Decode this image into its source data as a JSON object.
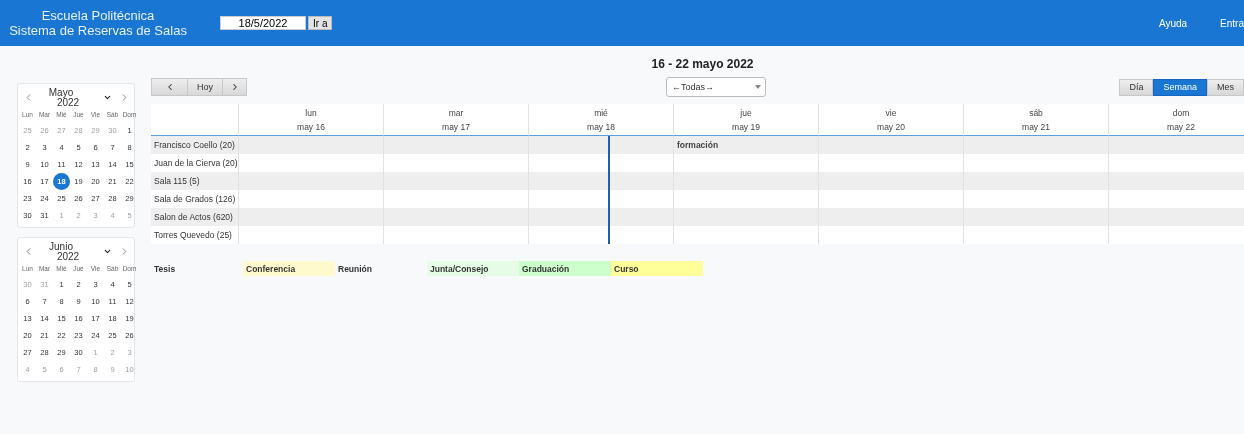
{
  "header": {
    "title_lines": [
      "Escuela Politécnica",
      "Sistema de Reservas de Salas"
    ],
    "date_field": {
      "value": "18/5/2022"
    },
    "go_button": "Ir a",
    "links": [
      "Ayuda",
      "Entra"
    ]
  },
  "mini_calendars": [
    {
      "month": "Mayo",
      "year": "2022",
      "weekdays": [
        "Lun",
        "Mar",
        "Mié",
        "Jue",
        "Vie",
        "Sáb",
        "Dom"
      ],
      "days": [
        {
          "label": "25",
          "outside": true,
          "selected": false
        },
        {
          "label": "26",
          "outside": true,
          "selected": false
        },
        {
          "label": "27",
          "outside": true,
          "selected": false
        },
        {
          "label": "28",
          "outside": true,
          "selected": false
        },
        {
          "label": "29",
          "outside": true,
          "selected": false
        },
        {
          "label": "30",
          "outside": true,
          "selected": false
        },
        {
          "label": "1",
          "outside": false,
          "selected": false
        },
        {
          "label": "2",
          "outside": false,
          "selected": false
        },
        {
          "label": "3",
          "outside": false,
          "selected": false
        },
        {
          "label": "4",
          "outside": false,
          "selected": false
        },
        {
          "label": "5",
          "outside": false,
          "selected": false
        },
        {
          "label": "6",
          "outside": false,
          "selected": false
        },
        {
          "label": "7",
          "outside": false,
          "selected": false
        },
        {
          "label": "8",
          "outside": false,
          "selected": false
        },
        {
          "label": "9",
          "outside": false,
          "selected": false
        },
        {
          "label": "10",
          "outside": false,
          "selected": false
        },
        {
          "label": "11",
          "outside": false,
          "selected": false
        },
        {
          "label": "12",
          "outside": false,
          "selected": false
        },
        {
          "label": "13",
          "outside": false,
          "selected": false
        },
        {
          "label": "14",
          "outside": false,
          "selected": false
        },
        {
          "label": "15",
          "outside": false,
          "selected": false
        },
        {
          "label": "16",
          "outside": false,
          "selected": false
        },
        {
          "label": "17",
          "outside": false,
          "selected": false
        },
        {
          "label": "18",
          "outside": false,
          "selected": true
        },
        {
          "label": "19",
          "outside": false,
          "selected": false
        },
        {
          "label": "20",
          "outside": false,
          "selected": false
        },
        {
          "label": "21",
          "outside": false,
          "selected": false
        },
        {
          "label": "22",
          "outside": false,
          "selected": false
        },
        {
          "label": "23",
          "outside": false,
          "selected": false
        },
        {
          "label": "24",
          "outside": false,
          "selected": false
        },
        {
          "label": "25",
          "outside": false,
          "selected": false
        },
        {
          "label": "26",
          "outside": false,
          "selected": false
        },
        {
          "label": "27",
          "outside": false,
          "selected": false
        },
        {
          "label": "28",
          "outside": false,
          "selected": false
        },
        {
          "label": "29",
          "outside": false,
          "selected": false
        },
        {
          "label": "30",
          "outside": false,
          "selected": false
        },
        {
          "label": "31",
          "outside": false,
          "selected": false
        },
        {
          "label": "1",
          "outside": true,
          "selected": false
        },
        {
          "label": "2",
          "outside": true,
          "selected": false
        },
        {
          "label": "3",
          "outside": true,
          "selected": false
        },
        {
          "label": "4",
          "outside": true,
          "selected": false
        },
        {
          "label": "5",
          "outside": true,
          "selected": false
        }
      ]
    },
    {
      "month": "Junio",
      "year": "2022",
      "weekdays": [
        "Lun",
        "Mar",
        "Mié",
        "Jue",
        "Vie",
        "Sáb",
        "Dom"
      ],
      "days": [
        {
          "label": "30",
          "outside": true,
          "selected": false
        },
        {
          "label": "31",
          "outside": true,
          "selected": false
        },
        {
          "label": "1",
          "outside": false,
          "selected": false
        },
        {
          "label": "2",
          "outside": false,
          "selected": false
        },
        {
          "label": "3",
          "outside": false,
          "selected": false
        },
        {
          "label": "4",
          "outside": false,
          "selected": false
        },
        {
          "label": "5",
          "outside": false,
          "selected": false
        },
        {
          "label": "6",
          "outside": false,
          "selected": false
        },
        {
          "label": "7",
          "outside": false,
          "selected": false
        },
        {
          "label": "8",
          "outside": false,
          "selected": false
        },
        {
          "label": "9",
          "outside": false,
          "selected": false
        },
        {
          "label": "10",
          "outside": false,
          "selected": false
        },
        {
          "label": "11",
          "outside": false,
          "selected": false
        },
        {
          "label": "12",
          "outside": false,
          "selected": false
        },
        {
          "label": "13",
          "outside": false,
          "selected": false
        },
        {
          "label": "14",
          "outside": false,
          "selected": false
        },
        {
          "label": "15",
          "outside": false,
          "selected": false
        },
        {
          "label": "16",
          "outside": false,
          "selected": false
        },
        {
          "label": "17",
          "outside": false,
          "selected": false
        },
        {
          "label": "18",
          "outside": false,
          "selected": false
        },
        {
          "label": "19",
          "outside": false,
          "selected": false
        },
        {
          "label": "20",
          "outside": false,
          "selected": false
        },
        {
          "label": "21",
          "outside": false,
          "selected": false
        },
        {
          "label": "22",
          "outside": false,
          "selected": false
        },
        {
          "label": "23",
          "outside": false,
          "selected": false
        },
        {
          "label": "24",
          "outside": false,
          "selected": false
        },
        {
          "label": "25",
          "outside": false,
          "selected": false
        },
        {
          "label": "26",
          "outside": false,
          "selected": false
        },
        {
          "label": "27",
          "outside": false,
          "selected": false
        },
        {
          "label": "28",
          "outside": false,
          "selected": false
        },
        {
          "label": "29",
          "outside": false,
          "selected": false
        },
        {
          "label": "30",
          "outside": false,
          "selected": false
        },
        {
          "label": "1",
          "outside": true,
          "selected": false
        },
        {
          "label": "2",
          "outside": true,
          "selected": false
        },
        {
          "label": "3",
          "outside": true,
          "selected": false
        },
        {
          "label": "4",
          "outside": true,
          "selected": false
        },
        {
          "label": "5",
          "outside": true,
          "selected": false
        },
        {
          "label": "6",
          "outside": true,
          "selected": false
        },
        {
          "label": "7",
          "outside": true,
          "selected": false
        },
        {
          "label": "8",
          "outside": true,
          "selected": false
        },
        {
          "label": "9",
          "outside": true,
          "selected": false
        },
        {
          "label": "10",
          "outside": true,
          "selected": false
        }
      ]
    }
  ],
  "range_title": "16 - 22 mayo 2022",
  "nav": {
    "today": "Hoy"
  },
  "room_filter": {
    "value": "←Todas→"
  },
  "views": [
    {
      "label": "Día",
      "selected": false
    },
    {
      "label": "Semana",
      "selected": true
    },
    {
      "label": "Mes",
      "selected": false
    }
  ],
  "days": [
    {
      "weekday": "lun",
      "date": "may 16",
      "today": false
    },
    {
      "weekday": "mar",
      "date": "may 17",
      "today": false
    },
    {
      "weekday": "mié",
      "date": "may 18",
      "today": true
    },
    {
      "weekday": "jue",
      "date": "may 19",
      "today": false
    },
    {
      "weekday": "vie",
      "date": "may 20",
      "today": false
    },
    {
      "weekday": "sáb",
      "date": "may 21",
      "today": false
    },
    {
      "weekday": "dom",
      "date": "may 22",
      "today": false
    }
  ],
  "rooms": [
    {
      "name": "Francisco Coello (20)",
      "slots": [
        {
          "kind": "free"
        },
        {
          "kind": "free"
        },
        {
          "kind": "free"
        },
        {
          "kind": "event",
          "event": "formación"
        },
        {
          "kind": "free"
        },
        {
          "kind": "free"
        },
        {
          "kind": "free"
        }
      ]
    },
    {
      "name": "Juan de la Cierva (20)",
      "slots": [
        {
          "kind": "free"
        },
        {
          "kind": "free"
        },
        {
          "kind": "free"
        },
        {
          "kind": "free"
        },
        {
          "kind": "free"
        },
        {
          "kind": "free"
        },
        {
          "kind": "free"
        }
      ]
    },
    {
      "name": "Sala 115 (5)",
      "slots": [
        {
          "kind": "free"
        },
        {
          "kind": "free"
        },
        {
          "kind": "free"
        },
        {
          "kind": "free"
        },
        {
          "kind": "free"
        },
        {
          "kind": "free"
        },
        {
          "kind": "free"
        }
      ]
    },
    {
      "name": "Sala de Grados (126)",
      "slots": [
        {
          "kind": "free"
        },
        {
          "kind": "free"
        },
        {
          "kind": "free"
        },
        {
          "kind": "free"
        },
        {
          "kind": "free"
        },
        {
          "kind": "free"
        },
        {
          "kind": "free"
        }
      ]
    },
    {
      "name": "Salon de Actos (620)",
      "slots": [
        {
          "kind": "free"
        },
        {
          "kind": "free"
        },
        {
          "kind": "free"
        },
        {
          "kind": "free"
        },
        {
          "kind": "free"
        },
        {
          "kind": "free"
        },
        {
          "kind": "free"
        }
      ]
    },
    {
      "name": "Torres Quevedo (25)",
      "slots": [
        {
          "kind": "free"
        },
        {
          "kind": "free"
        },
        {
          "kind": "free"
        },
        {
          "kind": "free"
        },
        {
          "kind": "free"
        },
        {
          "kind": "free"
        },
        {
          "kind": "free"
        }
      ]
    }
  ],
  "legend": [
    {
      "label": "Tesis",
      "color": "#f7f9fb"
    },
    {
      "label": "Conferencia",
      "color": "#fffacd"
    },
    {
      "label": "Reunión",
      "color": "#f7f9fb"
    },
    {
      "label": "Junta/Consejo",
      "color": "#e6fce6"
    },
    {
      "label": "Graduación",
      "color": "#ccffcc"
    },
    {
      "label": "Curso",
      "color": "#ffff99"
    }
  ]
}
